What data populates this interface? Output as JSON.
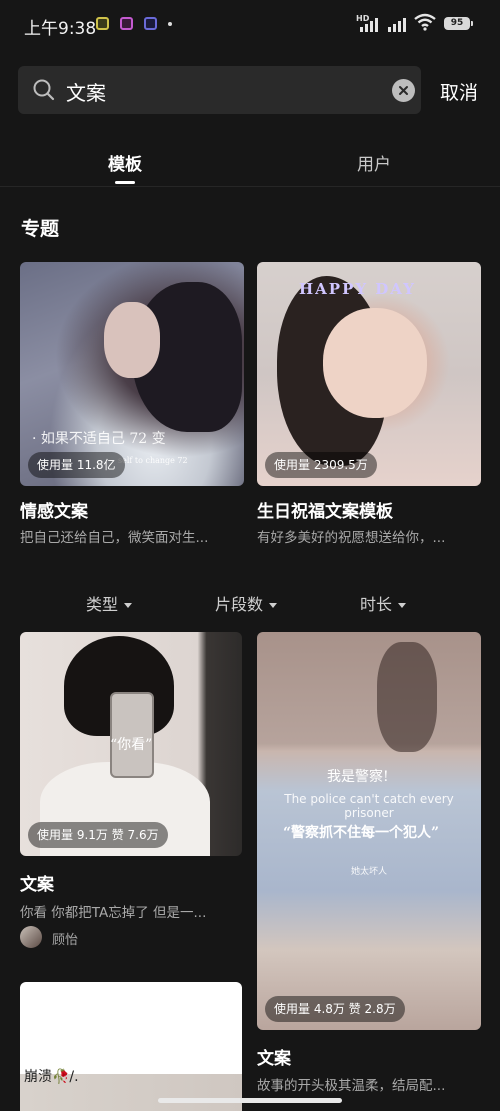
{
  "status_bar": {
    "time": "上午9:38",
    "network": "HD",
    "battery": "95"
  },
  "search": {
    "query": "文案",
    "cancel_label": "取消"
  },
  "tabs": [
    {
      "label": "模板"
    },
    {
      "label": "用户"
    }
  ],
  "section": {
    "title": "专题"
  },
  "topics": [
    {
      "title": "情感文案",
      "desc": "把自己还给自己，微笑面对生...",
      "usage": "使用量 11.8亿",
      "overlay": "· 如果不适自己 72 变",
      "overlay_sub": "self to change 72"
    },
    {
      "title": "生日祝福文案模板",
      "desc": "有好多美好的祝愿想送给你，...",
      "usage": "使用量 2309.5万",
      "overlay": "HAPPY DAY"
    }
  ],
  "filters": [
    {
      "label": "类型"
    },
    {
      "label": "片段数"
    },
    {
      "label": "时长"
    }
  ],
  "templates": [
    {
      "title": "文案",
      "desc": "你看 你都把TA忘掉了 但是一...",
      "usage": "使用量 9.1万 赞 7.6万",
      "author": "顾怡",
      "overlay": "“你看”"
    },
    {
      "title": "文案",
      "desc": "故事的开头极其温柔，结局配...",
      "usage": "使用量 4.8万 赞 2.8万",
      "overlay_top": "我是警察!",
      "overlay_en": "The police can't catch every prisoner",
      "overlay_cn": "“警察抓不住每一个犯人”",
      "overlay_small": "她太坏人"
    },
    {
      "overlay": "崩溃🥀/."
    }
  ]
}
